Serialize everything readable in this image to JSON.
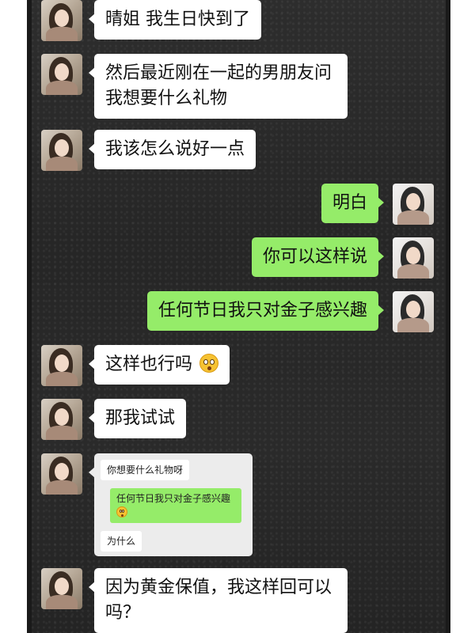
{
  "messages": [
    {
      "side": "in",
      "text": "晴姐  我生日快到了"
    },
    {
      "side": "in",
      "lines": [
        "然后最近刚在一起的男朋友问",
        "我想要什么礼物"
      ]
    },
    {
      "side": "in",
      "text": "我该怎么说好一点"
    },
    {
      "side": "out",
      "text": "明白"
    },
    {
      "side": "out",
      "text": "你可以这样说"
    },
    {
      "side": "out",
      "text": "任何节日我只对金子感兴趣"
    },
    {
      "side": "in",
      "text": "这样也行吗",
      "emoji": "astonished-face-icon"
    },
    {
      "side": "in",
      "text": "那我试试"
    },
    {
      "side": "in",
      "type": "screenshot",
      "screenshot": {
        "q1": "你想要什么礼物呀",
        "a1": "任何节日我只对金子感兴趣",
        "a1_emoji": "blushing-face-icon",
        "q2": "为什么"
      }
    },
    {
      "side": "in",
      "lines": [
        "因为黄金保值，我这样回可以",
        "吗？"
      ]
    }
  ],
  "colors": {
    "incoming_bubble": "#ffffff",
    "outgoing_bubble": "#95ec69",
    "background": "#2a2a2a"
  }
}
